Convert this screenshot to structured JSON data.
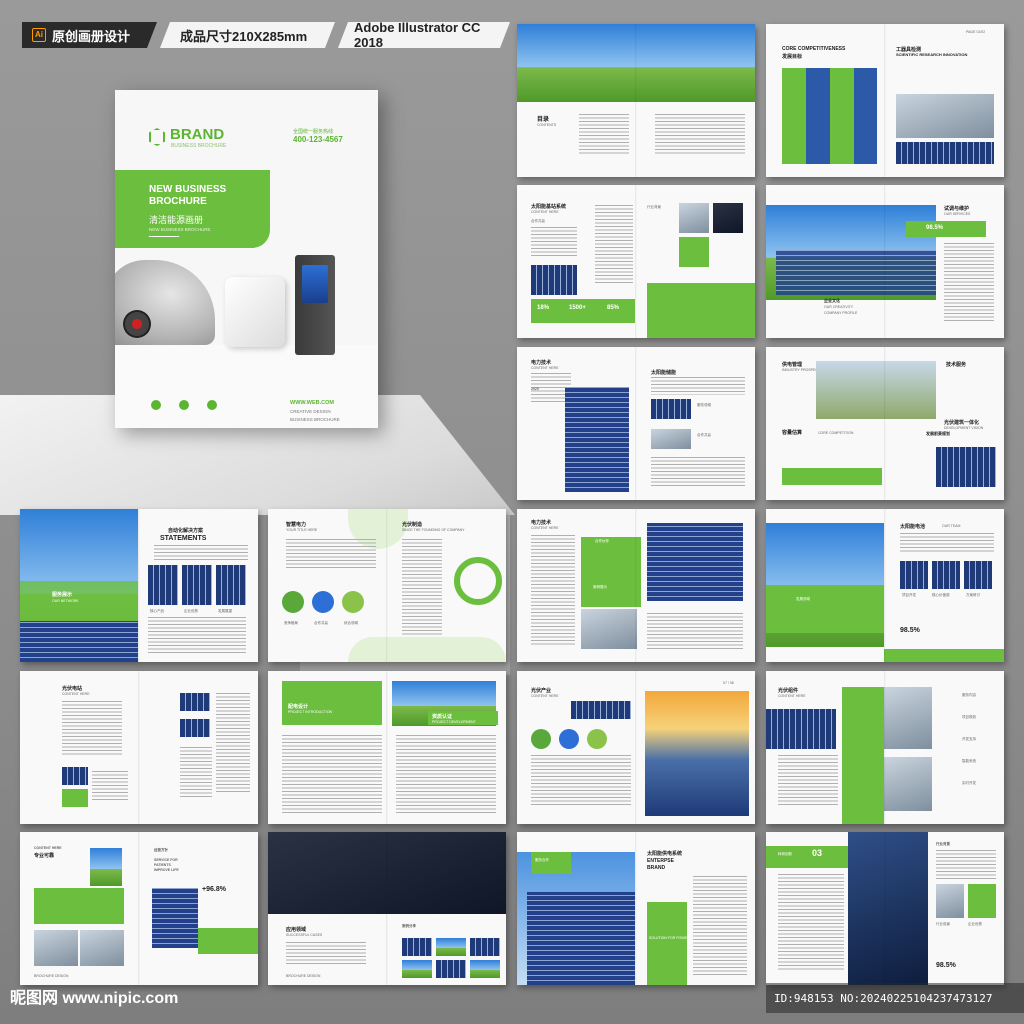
{
  "header": {
    "format_label": "原创画册设计",
    "size_label": "成品尺寸210X285mm",
    "software_label": "Adobe Illustrator CC 2018",
    "ai_badge": "Ai"
  },
  "cover": {
    "brand": "BRAND",
    "brand_sub": "BUSINESS BROCHURE",
    "hotline_label": "全国统一服务热线",
    "hotline": "400-123-4567",
    "title": "NEW BUSINESS BROCHURE",
    "title_cn": "清洁能源画册",
    "subtitle": "NEW BUSINESS BROCHURE",
    "website": "WWW.WEB.COM",
    "tagline_1": "CREATIVE DESIGN",
    "tagline_2": "BUSINESS BROCHURE"
  },
  "spreads": {
    "s2": {
      "title_cn": "目录",
      "title_en": "CONTENTS"
    },
    "s3": {
      "title_en": "CORE COMPETITIVENESS",
      "title_cn": "发展目标",
      "title_cn_2": "工器具检测",
      "title_en_2": "SCIENTIFIC RESEARCH INNOVATION",
      "page_tag": "PAGE 01/02"
    },
    "s4": {
      "title_cn": "太阳能基站系统",
      "title_en": "CONTENT HERE",
      "subtitle": "合作共赢",
      "tag": "行业背景",
      "stats": [
        "18%",
        "1500+",
        "85%"
      ]
    },
    "s5": {
      "title_cn": "试调与维护",
      "title_en": "OUR SERVICES",
      "percent": "98.5%",
      "profile_cn": "企业文化",
      "profile_1": "OUR CREATIVITY",
      "profile_2": "COMPANY PROFILE"
    },
    "s6": {
      "title_cn": "电力技术",
      "title_en": "CONTENT HERE",
      "year": "2025",
      "right_title": "太阳能储能",
      "label_1": "服务领域",
      "label_2": "合作共赢"
    },
    "s7": {
      "title_cn": "供电管理",
      "title_en": "INDUSTRY PROSPECTS",
      "right_title": "技术服务",
      "sub_1": "容量估算",
      "sub_en": "CORE COMPETITION",
      "right_sub": "发展前景规划",
      "right_sub_2": "光伏建筑一体化",
      "right_sub_en": "DEVELOPMENT VISION"
    },
    "s8": {
      "overlay_cn": "服务展示",
      "overlay_en": "OUR NETWORK",
      "title_cn": "自动化解决方案",
      "title_en": "STATEMENTS",
      "labels": [
        "核心产品",
        "企业优势",
        "发展展望"
      ]
    },
    "s9": {
      "title_cn": "智慧电力",
      "title_en": "YOUR TITLE HERE",
      "right_title": "光伏制造",
      "right_en": "SINCE THE FOUNDING OF COMPANY",
      "labels": [
        "竞争格局",
        "合作共赢",
        "综合领域"
      ]
    },
    "s10": {
      "title_cn": "电力技术",
      "title_en": "CONTENT HERE",
      "label_1": "合作伙伴",
      "label_2": "案例展示"
    },
    "s11": {
      "title_cn": "太阳能电池",
      "title_en": "OUR TEAM",
      "labels": [
        "项目开发",
        "核心价值观",
        "方案研讨"
      ],
      "percent": "98.5%",
      "badge": "发展领域"
    },
    "s12": {
      "title_cn": "光伏电站",
      "title_en": "CONTENT HERE"
    },
    "s13": {
      "title_cn": "配电设计",
      "title_en": "PROJECT INTRODUCTION",
      "right_title": "资质认证",
      "right_en": "PROJECT DEVELOPMENT"
    },
    "s14": {
      "title_cn": "光伏产业",
      "title_en": "CONTENT HERE",
      "page_tag": "07 / 08"
    },
    "s15": {
      "title_cn": "光伏组件",
      "title_en": "CONTENT HERE",
      "labels": [
        "服务内容",
        "项目规划",
        "开发支持",
        "智能系统",
        "实时开发"
      ]
    },
    "s16": {
      "title_en": "CONTENT HERE",
      "title_cn": "专业可靠",
      "right_tag": "经营方针",
      "right_en_1": "SERVICE FOR",
      "right_en_2": "PATIENTS",
      "right_en_3": "IMPROVE LIFE",
      "percent": "+96.8%",
      "footer": "BROCHURE DESIGN"
    },
    "s17": {
      "title_cn": "应用领域",
      "title_en": "SUCCESSFUL CASES",
      "right_title": "案例分享",
      "footer": "BROCHURE DESIGN"
    },
    "s18": {
      "tag_cn": "服务合作",
      "title_cn": "太阳能供电系统",
      "title_en_1": "ENTERPSE",
      "title_en_2": "BRAND",
      "sub": "SOLUTION FOR POWER"
    },
    "s19": {
      "tag_cn": "科研创新",
      "tag_num": "03",
      "right_tag": "行业背景",
      "label_1": "行业前景",
      "label_2": "企业优势",
      "percent": "98.5%"
    }
  },
  "footer": {
    "watermark": "昵图网 www.nipic.com",
    "id_text": "ID:948153 NO:20240225104237473127"
  },
  "colors": {
    "accent_green": "#6cbf3e",
    "dark_green": "#4aa32a",
    "solar_blue": "#1e3a78"
  }
}
